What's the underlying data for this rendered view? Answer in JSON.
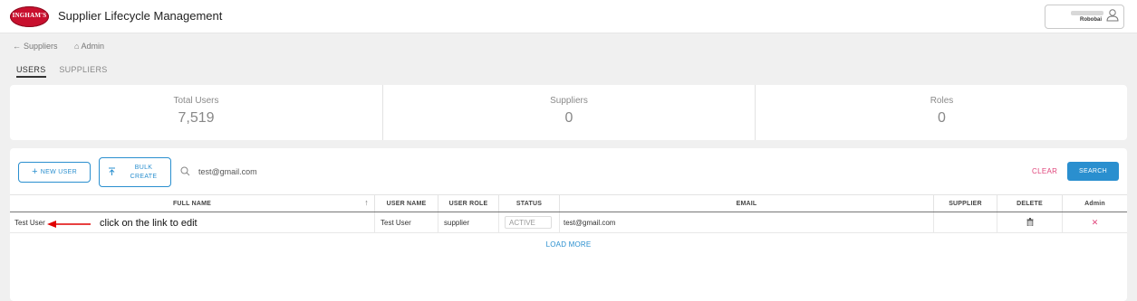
{
  "header": {
    "logo_text": "INGHAM'S",
    "app_title": "Supplier Lifecycle Management",
    "user_name": "Robobai"
  },
  "breadcrumb": {
    "back": "Suppliers",
    "home": "Admin"
  },
  "tabs": [
    {
      "label": "USERS",
      "active": true
    },
    {
      "label": "SUPPLIERS",
      "active": false
    }
  ],
  "stats": [
    {
      "label": "Total Users",
      "value": "7,519"
    },
    {
      "label": "Suppliers",
      "value": "0"
    },
    {
      "label": "Roles",
      "value": "0"
    }
  ],
  "toolbar": {
    "new_user_label": "NEW USER",
    "bulk_create_line1": "BULK",
    "bulk_create_line2": "CREATE",
    "search_value": "test@gmail.com",
    "clear_label": "CLEAR",
    "search_label": "SEARCH"
  },
  "table": {
    "headers": [
      "FULL NAME",
      "USER NAME",
      "USER ROLE",
      "STATUS",
      "EMAIL",
      "SUPPLIER",
      "DELETE",
      "Admin"
    ],
    "rows": [
      {
        "full_name": "Test User",
        "user_name": "Test User",
        "user_role": "supplier",
        "status": "ACTIVE",
        "email": "test@gmail.com",
        "supplier": ""
      }
    ]
  },
  "load_more_label": "LOAD MORE",
  "annotation": "click on the link  to edit",
  "colors": {
    "accent": "#2a8fcf",
    "clear": "#e0457b",
    "brand": "#c8102e",
    "annotation_arrow": "#e00000"
  }
}
